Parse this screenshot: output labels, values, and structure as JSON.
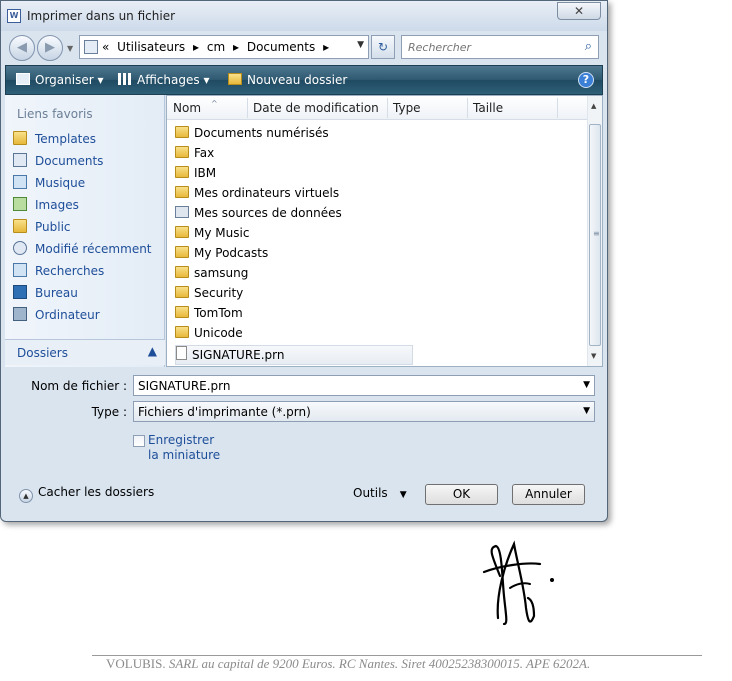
{
  "window": {
    "title": "Imprimer dans un fichier",
    "close": "✕"
  },
  "nav": {
    "back": "◀",
    "forward": "▶",
    "path": [
      "«",
      "Utilisateurs",
      "▸",
      "cm",
      "▸",
      "Documents",
      "▸"
    ],
    "refresh": "↻",
    "search_placeholder": "Rechercher"
  },
  "toolbar": {
    "organize": "Organiser",
    "views": "Affichages",
    "new_folder": "Nouveau dossier",
    "help": "?"
  },
  "favorites": {
    "header": "Liens favoris",
    "items": [
      "Templates",
      "Documents",
      "Musique",
      "Images",
      "Public",
      "Modifié récemment",
      "Recherches",
      "Bureau",
      "Ordinateur"
    ],
    "folders_label": "Dossiers"
  },
  "columns": {
    "name": "Nom",
    "date": "Date de modification",
    "type": "Type",
    "size": "Taille"
  },
  "files": [
    "Documents numérisés",
    "Fax",
    "IBM",
    "Mes ordinateurs virtuels",
    "Mes sources de données",
    "My Music",
    "My Podcasts",
    "samsung",
    "Security",
    "TomTom",
    "Unicode",
    "SIGNATURE.prn"
  ],
  "form": {
    "filename_label": "Nom de fichier :",
    "filename_value": "SIGNATURE.prn",
    "type_label": "Type :",
    "type_value": "Fichiers d'imprimante (*.prn)",
    "thumbnail_label": "Enregistrer la miniature"
  },
  "footer_buttons": {
    "hide_folders": "Cacher les dossiers",
    "tools": "Outils",
    "ok": "OK",
    "cancel": "Annuler"
  },
  "letterhead": {
    "company": "VOLUBIS.",
    "details": "SARL au capital de 9200 Euros. RC Nantes. Siret 40025238300015. APE 6202A."
  }
}
